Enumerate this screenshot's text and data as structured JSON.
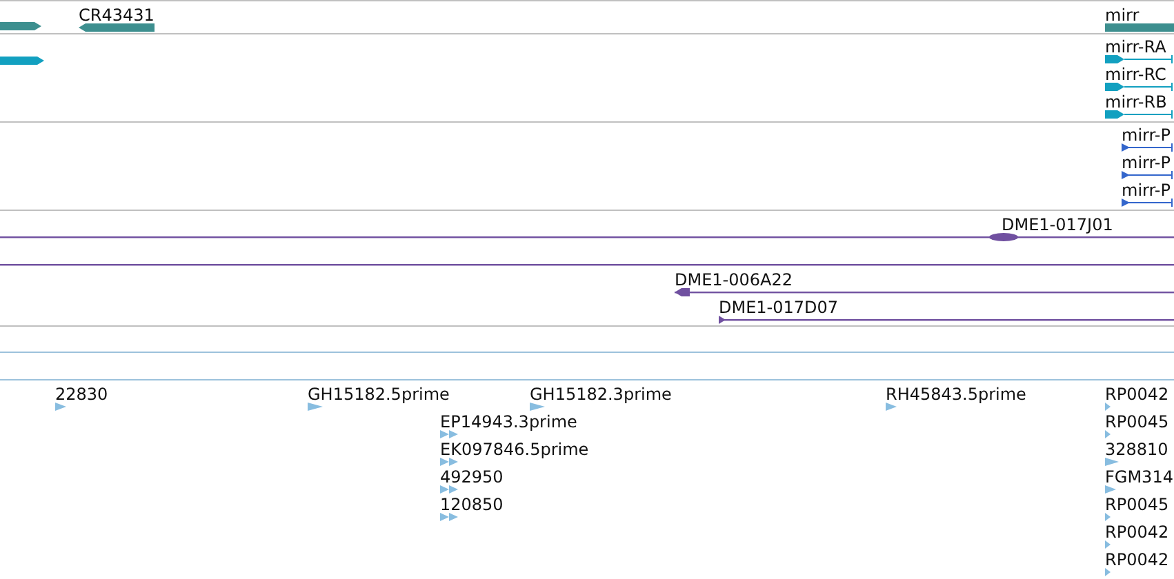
{
  "tracks": [
    {
      "kind": "gene",
      "features": [
        {
          "reverse": false
        },
        {
          "label": "CR43431",
          "reverse": true
        },
        {
          "label": "mirr"
        }
      ]
    },
    {
      "kind": "transcript",
      "features": [
        {
          "reverse": false
        },
        {
          "label": "mirr-RA",
          "reverse": false
        },
        {
          "label": "mirr-RC",
          "reverse": false
        },
        {
          "label": "mirr-RB",
          "reverse": false
        }
      ]
    },
    {
      "kind": "protein",
      "features": [
        {
          "label": "mirr-P",
          "reverse": false
        },
        {
          "label": "mirr-P",
          "reverse": false
        },
        {
          "label": "mirr-P",
          "reverse": false
        }
      ]
    },
    {
      "kind": "clone",
      "features": [
        {
          "kind": "span"
        },
        {
          "label": "DME1-017J01",
          "kind": "blob"
        },
        {
          "kind": "span"
        }
      ]
    },
    {
      "kind": "clone",
      "features": [
        {
          "label": "DME1-006A22",
          "reverse": true
        },
        {
          "label": "DME1-017D07",
          "reverse": false
        }
      ]
    },
    {
      "kind": "empty"
    },
    {
      "kind": "empty"
    },
    {
      "kind": "est",
      "features": [
        {
          "label": "22830",
          "reverse": false
        },
        {
          "label": "GH15182.5prime",
          "reverse": false
        },
        {
          "label": "GH15182.3prime",
          "reverse": false
        },
        {
          "label": "EP14943.3prime",
          "reverse": false
        },
        {
          "label": "EK097846.5prime",
          "reverse": false
        },
        {
          "label": "492950",
          "reverse": false
        },
        {
          "label": "120850",
          "reverse": false
        },
        {
          "label": "RH45843.5prime",
          "reverse": false
        },
        {
          "label": "RP0042",
          "reverse": false
        },
        {
          "label": "RP0045",
          "reverse": false
        },
        {
          "label": "328810",
          "reverse": false
        },
        {
          "label": "FGM314",
          "reverse": false
        },
        {
          "label": "RP0045",
          "reverse": false
        },
        {
          "label": "RP0042",
          "reverse": false
        },
        {
          "label": "RP0042",
          "reverse": false
        }
      ]
    }
  ]
}
